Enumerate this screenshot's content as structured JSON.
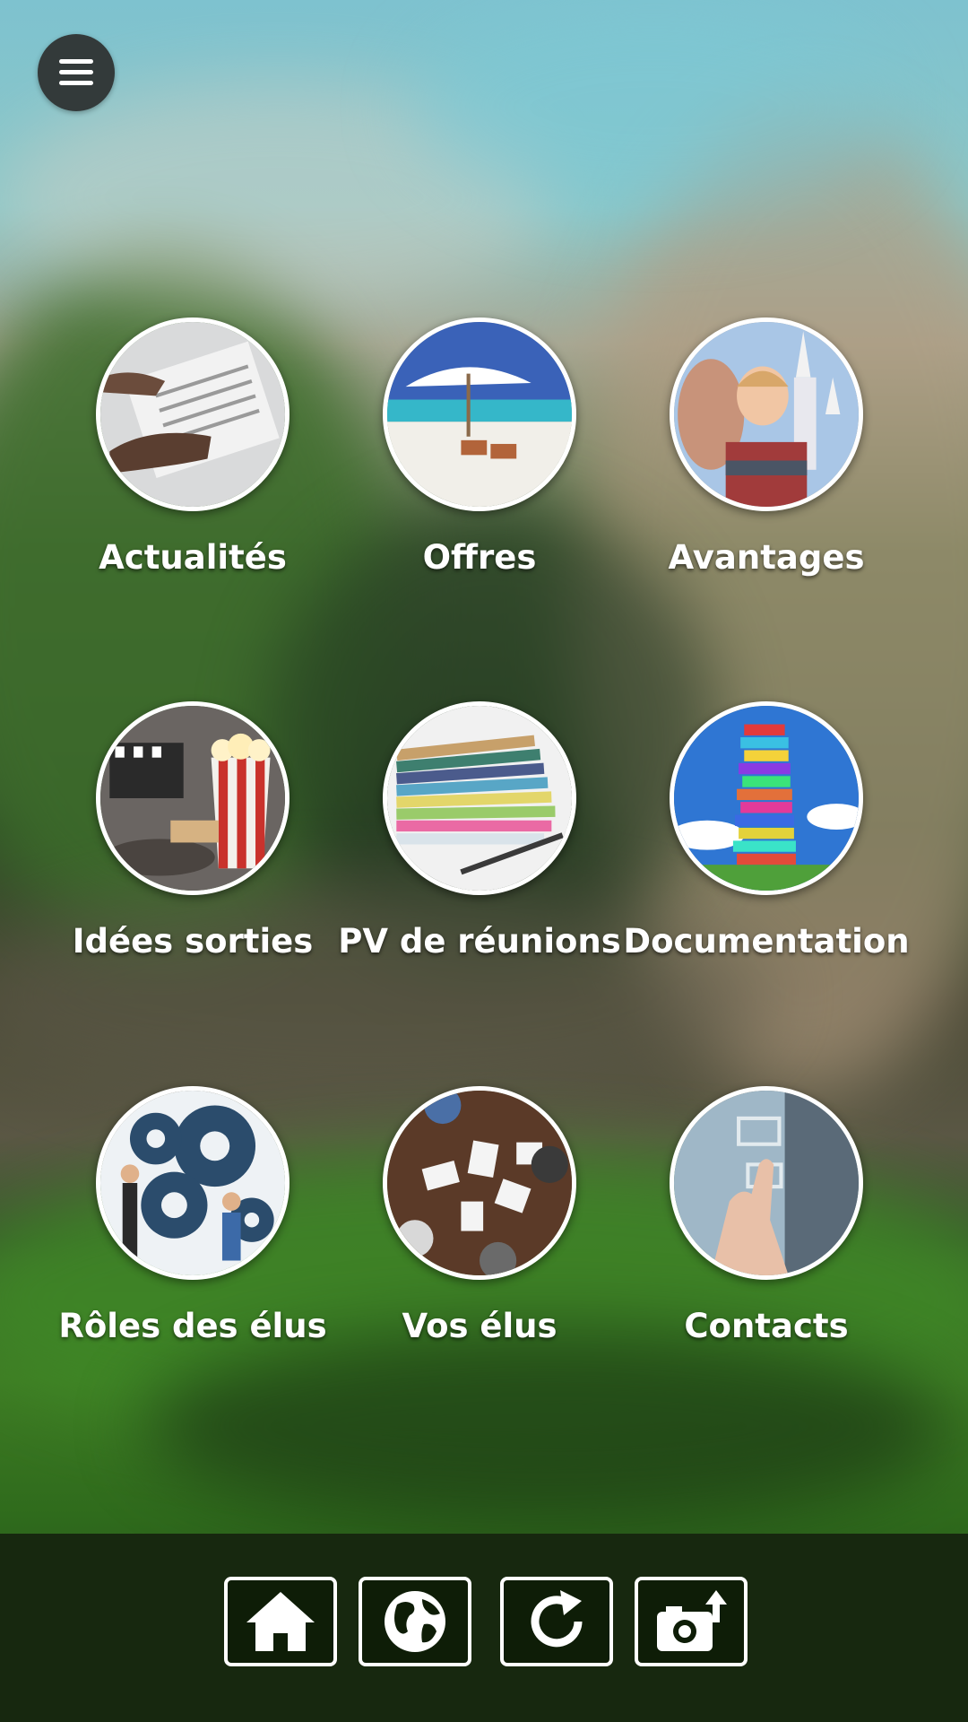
{
  "header": {
    "menu_icon": "hamburger-menu-icon"
  },
  "tiles": [
    {
      "label": "Actualités",
      "icon": "newspaper-photo"
    },
    {
      "label": "Offres",
      "icon": "beach-umbrella-photo"
    },
    {
      "label": "Avantages",
      "icon": "father-son-castle-photo"
    },
    {
      "label": "Idées sorties",
      "icon": "cinema-popcorn-photo"
    },
    {
      "label": "PV de réunions",
      "icon": "paper-stack-photo"
    },
    {
      "label": "Documentation",
      "icon": "book-tower-photo"
    },
    {
      "label": "Rôles des élus",
      "icon": "gears-people-photo"
    },
    {
      "label": "Vos élus",
      "icon": "meeting-table-photo"
    },
    {
      "label": "Contacts",
      "icon": "touchscreen-contact-photo"
    }
  ],
  "toolbar": {
    "buttons": [
      {
        "icon": "home-icon"
      },
      {
        "icon": "globe-icon"
      },
      {
        "icon": "refresh-icon"
      },
      {
        "icon": "camera-upload-icon"
      }
    ]
  },
  "colors": {
    "toolbar_bg": "#17280f",
    "menu_bg": "#333a3a",
    "label": "#ffffff"
  }
}
